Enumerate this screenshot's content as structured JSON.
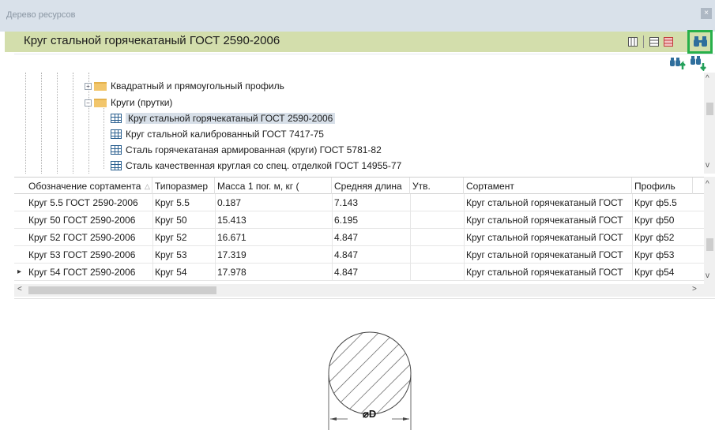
{
  "window": {
    "title": "Дерево ресурсов",
    "close_glyph": "×"
  },
  "header": {
    "title": "Круг стальной горячекатаный ГОСТ 2590-2006"
  },
  "toolbar_icons": [
    "columns-view-icon",
    "table-view-icon",
    "red-table-view-icon",
    "binoculars-find-icon",
    "find-previous-icon",
    "find-next-icon"
  ],
  "tree": {
    "items": [
      {
        "label": "Квадратный и прямоугольный профиль",
        "type": "folder",
        "expander": "+"
      },
      {
        "label": "Круги (прутки)",
        "type": "folder",
        "expander": "−"
      },
      {
        "label": "Круг стальной горячекатаный ГОСТ 2590-2006",
        "type": "table",
        "selected": true
      },
      {
        "label": "Круг стальной калиброванный ГОСТ 7417-75",
        "type": "table"
      },
      {
        "label": "Сталь горячекатаная армированная (круги) ГОСТ 5781-82",
        "type": "table"
      },
      {
        "label": "Сталь качественная круглая со спец. отделкой ГОСТ 14955-77",
        "type": "table"
      }
    ]
  },
  "table": {
    "columns": [
      "Обозначение сортамента",
      "Типоразмер",
      "Масса 1 пог. м, кг (",
      "Средняя длина",
      "Утв.",
      "Сортамент",
      "Профиль"
    ],
    "sort_glyph": "△",
    "current_row_glyph": "▸",
    "rows": [
      [
        "Круг 5.5 ГОСТ 2590-2006",
        "Круг 5.5",
        "0.187",
        "7.143",
        "",
        "Круг стальной горячекатаный ГОСТ",
        "Круг ф5.5"
      ],
      [
        "Круг 50 ГОСТ 2590-2006",
        "Круг 50",
        "15.413",
        "6.195",
        "",
        "Круг стальной горячекатаный ГОСТ",
        "Круг ф50"
      ],
      [
        "Круг 52 ГОСТ 2590-2006",
        "Круг 52",
        "16.671",
        "4.847",
        "",
        "Круг стальной горячекатаный ГОСТ",
        "Круг ф52"
      ],
      [
        "Круг 53 ГОСТ 2590-2006",
        "Круг 53",
        "17.319",
        "4.847",
        "",
        "Круг стальной горячекатаный ГОСТ",
        "Круг ф53"
      ],
      [
        "Круг 54 ГОСТ 2590-2006",
        "Круг 54",
        "17.978",
        "4.847",
        "",
        "Круг стальной горячекатаный ГОСТ",
        "Круг ф54"
      ]
    ]
  },
  "preview": {
    "dimension_label": "⌀D"
  },
  "scroll": {
    "up": "^",
    "down": "v",
    "left": "<",
    "right": ">"
  },
  "colors": {
    "header_bg": "#d3deac",
    "titlebar_bg": "#d9e1ea",
    "highlight_border": "#27b04a",
    "selection_bg": "#d7dfe8"
  }
}
